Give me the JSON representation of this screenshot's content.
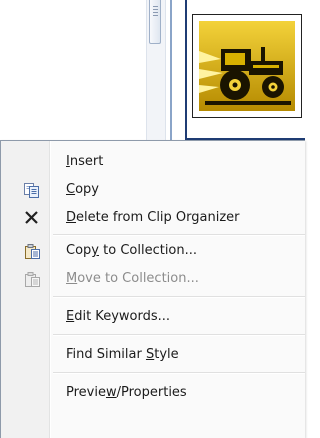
{
  "icons": {
    "copy": "copy-icon",
    "delete": "delete-x-icon",
    "copy_to_collection": "copy-to-collection-icon",
    "move_to_collection": "move-to-collection-icon",
    "clip": "tractor-clipart-icon"
  },
  "colors": {
    "menu_background": "#fafafa",
    "gutter": "#f1f1f1",
    "disabled_text": "#8c8c8c",
    "clip_border": "#1f3c74",
    "clip_art_gold": "#c8a000"
  },
  "context_menu": {
    "items": [
      {
        "key": "insert",
        "label_pre": "",
        "mnemonic": "I",
        "label_post": "nsert",
        "enabled": true,
        "icon": ""
      },
      {
        "key": "copy",
        "label_pre": "",
        "mnemonic": "C",
        "label_post": "opy",
        "enabled": true,
        "icon": "copy-icon"
      },
      {
        "key": "delete",
        "label_pre": "",
        "mnemonic": "D",
        "label_post": "elete from Clip Organizer",
        "enabled": true,
        "icon": "delete-x-icon"
      },
      {
        "key": "copy_to_collection",
        "label_pre": "Cop",
        "mnemonic": "y",
        "label_post": " to Collection...",
        "enabled": true,
        "icon": "copy-to-collection-icon"
      },
      {
        "key": "move_to_collection",
        "label_pre": "",
        "mnemonic": "M",
        "label_post": "ove to Collection...",
        "enabled": false,
        "icon": "move-to-collection-icon"
      },
      {
        "key": "edit_keywords",
        "label_pre": "",
        "mnemonic": "E",
        "label_post": "dit Keywords...",
        "enabled": true,
        "icon": ""
      },
      {
        "key": "find_similar_style",
        "label_pre": "Find Similar ",
        "mnemonic": "S",
        "label_post": "tyle",
        "enabled": true,
        "icon": ""
      },
      {
        "key": "preview_properties",
        "label_pre": "Previe",
        "mnemonic": "w",
        "label_post": "/Properties",
        "enabled": true,
        "icon": ""
      }
    ]
  }
}
